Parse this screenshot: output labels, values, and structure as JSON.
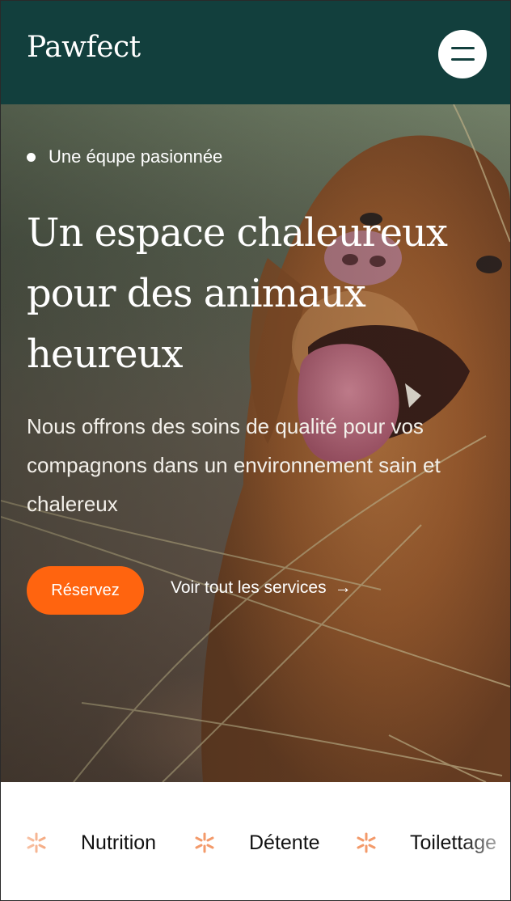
{
  "header": {
    "logo": "Pawfect",
    "menu_icon": "hamburger-menu-icon",
    "background_color": "#123f3d"
  },
  "hero": {
    "tagline": "Une équpe pasionnée",
    "title": "Un espace chaleureux pour des animaux heureux",
    "description": "Nous offrons des soins de qualité pour vos compagnons dans un environnement sain et chalereux",
    "primary_button": "Réservez",
    "secondary_link": "Voir tout les services",
    "secondary_link_icon": "arrow-right-icon",
    "accent_color": "#ff640f"
  },
  "services": {
    "items": [
      "Nutrition",
      "Détente",
      "Toilettage"
    ],
    "separator_icon": "sparkle-icon",
    "separator_color": "#f39a6a"
  }
}
